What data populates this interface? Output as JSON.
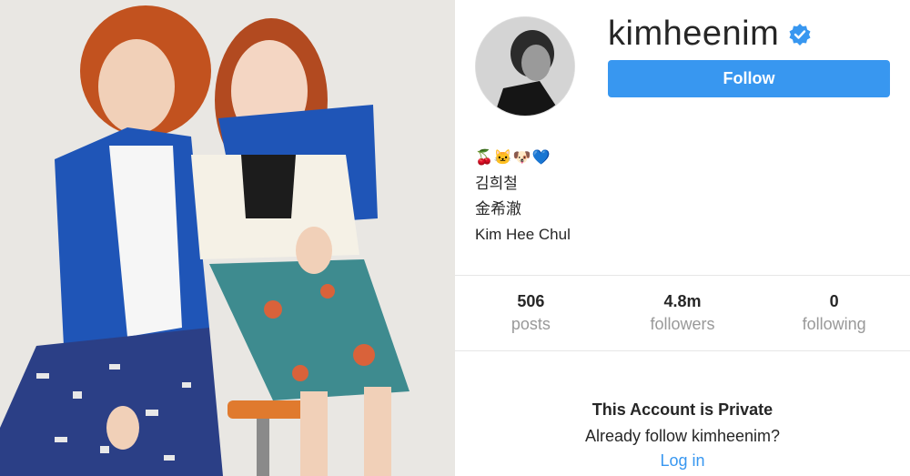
{
  "profile": {
    "username": "kimheenim",
    "follow_label": "Follow",
    "bio": {
      "emojis": "🍒🐱🐶💙",
      "line1": "김희철",
      "line2": "金希澈",
      "line3": "Kim Hee Chul"
    }
  },
  "stats": [
    {
      "value": "506",
      "label": "posts"
    },
    {
      "value": "4.8m",
      "label": "followers"
    },
    {
      "value": "0",
      "label": "following"
    }
  ],
  "private": {
    "title": "This Account is Private",
    "subtitle": "Already follow kimheenim?",
    "login_label": "Log in"
  },
  "colors": {
    "accent": "#3897f0",
    "verified": "#3897f0",
    "muted_text": "#999999",
    "text": "#262626"
  }
}
